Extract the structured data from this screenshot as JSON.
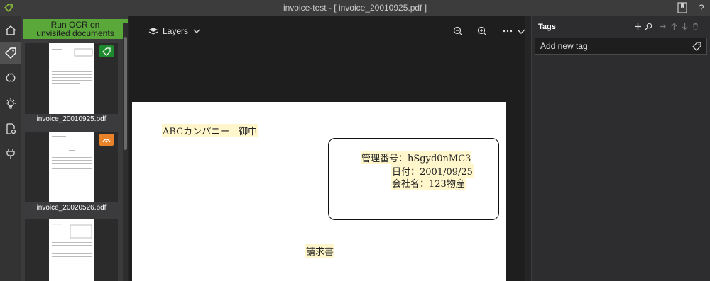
{
  "window": {
    "title": "invoice-test - [ invoice_20010925.pdf ]"
  },
  "sidebar": {
    "ocr_button_line1": "Run OCR on",
    "ocr_button_line2": "unvisited documents",
    "thumbnails": [
      {
        "name": "invoice_20010925.pdf",
        "badge": "tag-icon",
        "badge_color": "#1e8a2e"
      },
      {
        "name": "invoice_20020526.pdf",
        "badge": "visited-icon",
        "badge_color": "#e8832a"
      },
      {
        "name": ""
      }
    ]
  },
  "viewer": {
    "layers_label": "Layers",
    "document": {
      "line1": "ABCカンパニー　御中",
      "box_line1": "管理番号：hSgyd0nMC3",
      "box_line2": "日付：2001/09/25",
      "box_line3": "会社名：123物産",
      "heading": "請求書"
    }
  },
  "tags_panel": {
    "title": "Tags",
    "input_placeholder": "Add new tag"
  },
  "colors": {
    "accent_green": "#5aa73a",
    "badge_green": "#1e8a2e",
    "badge_orange": "#e8832a",
    "highlight": "#fff6cc"
  }
}
